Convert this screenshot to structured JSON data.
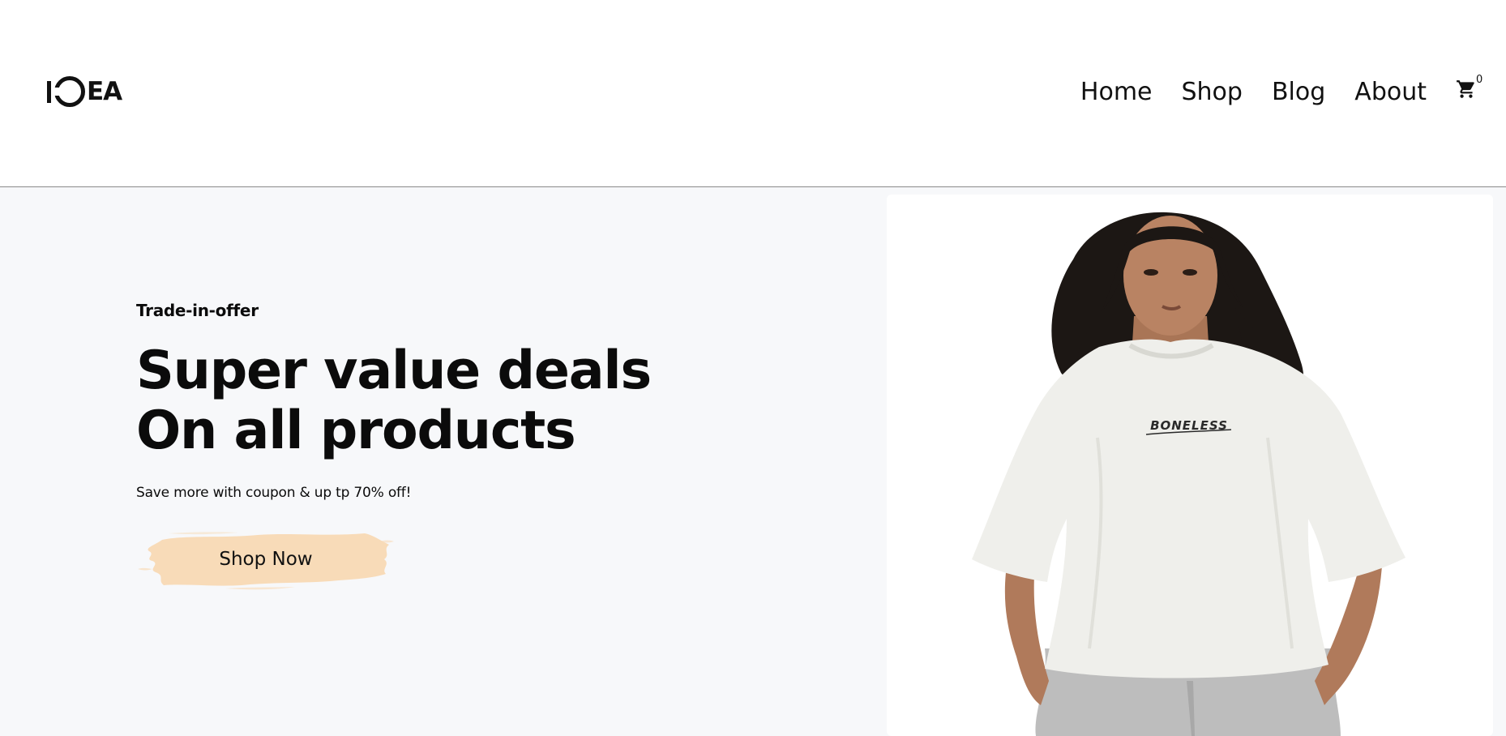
{
  "header": {
    "logo_text": "EA",
    "nav": [
      {
        "label": "Home"
      },
      {
        "label": "Shop"
      },
      {
        "label": "Blog"
      },
      {
        "label": "About"
      }
    ],
    "cart_count": "0"
  },
  "hero": {
    "kicker": "Trade-in-offer",
    "headline_line1": "Super value deals",
    "headline_line2": "On all products",
    "subtext": "Save more with coupon & up tp 70% off!",
    "cta_label": "Shop Now",
    "cta_color": "#f8dbb8",
    "shirt_print": "BONELESS"
  },
  "colors": {
    "hero_bg": "#f7f8fa",
    "text": "#0b0b0b"
  }
}
